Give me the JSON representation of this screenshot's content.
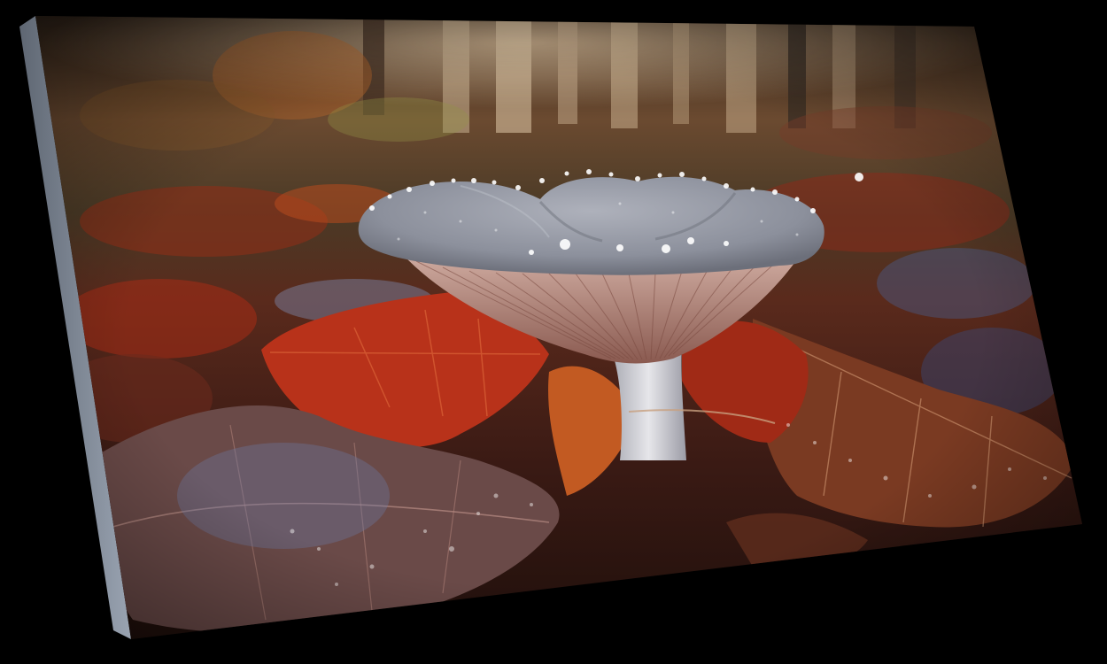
{
  "scene": {
    "subject": "mushroom",
    "colors": {
      "background": "#000000",
      "canvas_edge": "#8a96a6",
      "leaf_red": "#b8321a",
      "leaf_orange": "#c25a22",
      "leaf_brown": "#7a3a22",
      "mushroom_cap": "#9ea2ac",
      "mushroom_gills": "#c9a49a",
      "mushroom_stem": "#d8d8dc",
      "forest_light": "#e9c9a0",
      "dew_highlight": "#ffffff"
    }
  }
}
